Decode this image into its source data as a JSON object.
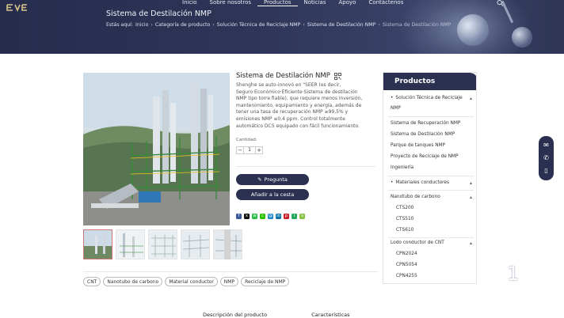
{
  "header": {
    "logo_text": "EVERLAND",
    "nav": [
      "Inicio",
      "Sobre nosotros",
      "Productos",
      "Noticias",
      "Apoyo",
      "Contáctenos"
    ],
    "nav_active": "Productos",
    "page_title": "Sistema de Destilación NMP",
    "breadcrumb_prefix": "Estás aquí:",
    "breadcrumb": [
      "Inicio",
      "Categoría de producto",
      "Solución Técnica de Reciclaje NMP",
      "Sistema de Destilación NMP",
      "Sistema de Destilación NMP"
    ]
  },
  "product": {
    "title": "Sistema de Destilación NMP",
    "description": "Shenghe se auto-innovó en \"SEER (es decir, Seguro·Económico·Eficiente·Sistema de destilación NMP tipo torre fiable), que requiere menos inversión, mantenimiento, equipamiento y energía, además de tener una tasa de recuperación NMP ≥99,5% y emisiones NMP ≤0,4 ppm. Control totalmente automático DCS equipado con fácil funcionamiento.",
    "quantity_label": "Cantidad:",
    "quantity_value": "1",
    "qty_minus": "−",
    "qty_plus": "+",
    "ask_button": "Pregunta",
    "cart_button": "Añadir a la cesta"
  },
  "tags": [
    "CNT",
    "Nanotubo de carbono",
    "Material conductor",
    "NMP",
    "Reciclaje de NMP"
  ],
  "categories": {
    "heading": "Productos",
    "items": [
      {
        "label": "Solución Técnica de Reciclaje",
        "dot": true,
        "arrow": "▴"
      },
      {
        "label": "NMP",
        "dot": false
      },
      {
        "label": "Sistema de Recuperación NMP",
        "dot": false
      },
      {
        "label": "Sistema de Destilación NMP",
        "dot": false
      },
      {
        "label": "Parque de tanques NMP",
        "dot": false
      },
      {
        "label": "Proyecto de Reciclaje de NMP",
        "dot": false
      },
      {
        "label": "Ingeniería",
        "dot": false
      },
      {
        "label": "Materiales conductores",
        "dot": true,
        "arrow": "▴"
      },
      {
        "label": "Nanotubo de carbono",
        "dot": false,
        "arrow": "▴"
      },
      {
        "label": "CTS200",
        "dot": false
      },
      {
        "label": "CTS510",
        "dot": false
      },
      {
        "label": "CTS610",
        "dot": false
      },
      {
        "label": "Lodo conductor de CNT",
        "dot": false,
        "arrow": "▴"
      },
      {
        "label": "CPN2024",
        "dot": false
      },
      {
        "label": "CPN5054",
        "dot": false
      },
      {
        "label": "CPN4255",
        "dot": false
      }
    ]
  },
  "bottom_tabs": [
    "Descripción del producto",
    "Características"
  ],
  "page_number": "1",
  "colors": {
    "primary": "#2c3151",
    "hero": "#2e3558"
  }
}
